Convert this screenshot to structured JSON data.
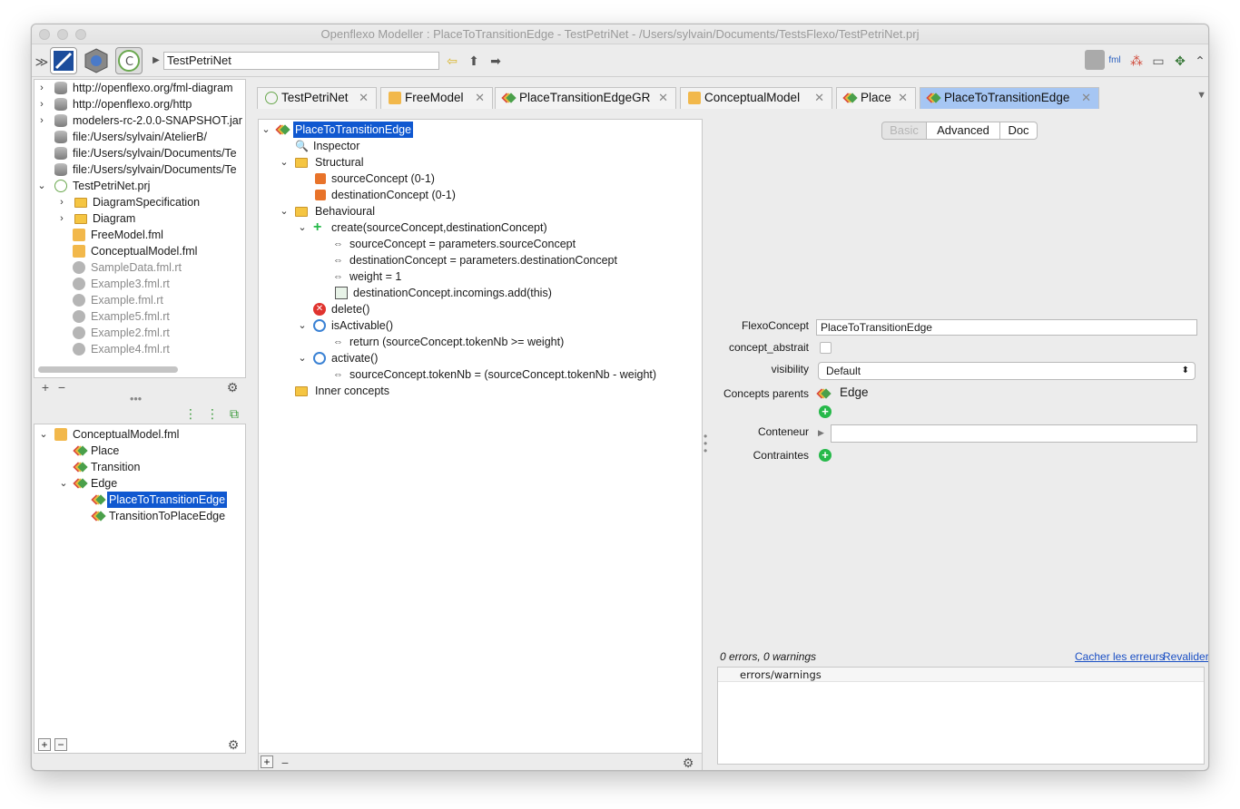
{
  "window": {
    "title": "Openflexo Modeller : PlaceToTransitionEdge - TestPetriNet - /Users/sylvain/Documents/TestsFlexo/TestPetriNet.prj"
  },
  "toolbar": {
    "breadcrumb": "TestPetriNet",
    "left_icons": [
      "expand-icon",
      "fml-editor-icon",
      "shield-icon",
      "conceptual-icon"
    ],
    "nav_icons": [
      "back-arrow-icon",
      "up-arrow-icon",
      "forward-arrow-icon"
    ],
    "right_icons": [
      "conceptual-icon",
      "fml-file-icon",
      "hierarchy-icon",
      "window-icon",
      "palette-icon",
      "collapse-icon"
    ]
  },
  "resources": {
    "items": [
      {
        "label": "http://openflexo.org/fml-diagram"
      },
      {
        "label": "http://openflexo.org/http"
      },
      {
        "label": "modelers-rc-2.0.0-SNAPSHOT.jar"
      },
      {
        "label": "file:/Users/sylvain/AtelierB/"
      },
      {
        "label": "file:/Users/sylvain/Documents/Te"
      },
      {
        "label": "file:/Users/sylvain/Documents/Te"
      },
      {
        "label": "TestPetriNet.prj"
      },
      {
        "label": "DiagramSpecification"
      },
      {
        "label": "Diagram"
      },
      {
        "label": "FreeModel.fml"
      },
      {
        "label": "ConceptualModel.fml"
      },
      {
        "label": "SampleData.fml.rt"
      },
      {
        "label": "Example3.fml.rt"
      },
      {
        "label": "Example.fml.rt"
      },
      {
        "label": "Example5.fml.rt"
      },
      {
        "label": "Example2.fml.rt"
      },
      {
        "label": "Example4.fml.rt"
      }
    ]
  },
  "model_tree": {
    "items": [
      {
        "label": "ConceptualModel.fml"
      },
      {
        "label": "Place"
      },
      {
        "label": "Transition"
      },
      {
        "label": "Edge"
      },
      {
        "label": "PlaceToTransitionEdge"
      },
      {
        "label": "TransitionToPlaceEdge"
      }
    ]
  },
  "tabs": [
    {
      "label": "TestPetriNet"
    },
    {
      "label": "FreeModel"
    },
    {
      "label": "PlaceTransitionEdgeGR"
    },
    {
      "label": "ConceptualModel"
    },
    {
      "label": "Place"
    },
    {
      "label": "PlaceToTransitionEdge"
    }
  ],
  "concept_tree": {
    "items": [
      {
        "label": "PlaceToTransitionEdge"
      },
      {
        "label": "Inspector"
      },
      {
        "label": "Structural"
      },
      {
        "label": "sourceConcept (0-1)"
      },
      {
        "label": "destinationConcept (0-1)"
      },
      {
        "label": "Behavioural"
      },
      {
        "label": "create(sourceConcept,destinationConcept)"
      },
      {
        "label": "sourceConcept = parameters.sourceConcept"
      },
      {
        "label": "destinationConcept = parameters.destinationConcept"
      },
      {
        "label": "weight = 1"
      },
      {
        "label": "destinationConcept.incomings.add(this)"
      },
      {
        "label": "delete()"
      },
      {
        "label": "isActivable()"
      },
      {
        "label": "return (sourceConcept.tokenNb >= weight)"
      },
      {
        "label": "activate()"
      },
      {
        "label": "sourceConcept.tokenNb = (sourceConcept.tokenNb - weight)"
      },
      {
        "label": "Inner concepts"
      }
    ]
  },
  "inspector": {
    "tabs": {
      "basic": "Basic",
      "advanced": "Advanced",
      "doc": "Doc"
    },
    "flexoconcept_label": "FlexoConcept",
    "flexoconcept_value": "PlaceToTransitionEdge",
    "abstract_label": "concept_abstrait",
    "visibility_label": "visibility",
    "visibility_value": "Default",
    "parents_label": "Concepts parents",
    "parent_value": "Edge",
    "container_label": "Conteneur",
    "container_value": "",
    "constraints_label": "Contraintes"
  },
  "validation": {
    "summary": "0 errors, 0 warnings",
    "hide_link": "Cacher les erreurs",
    "revalidate_link": "Revalider",
    "column_header": "errors/warnings"
  },
  "colors": {
    "selection": "#1058d0",
    "active_tab": "#a6c6f3",
    "add_green": "#26b94a"
  }
}
